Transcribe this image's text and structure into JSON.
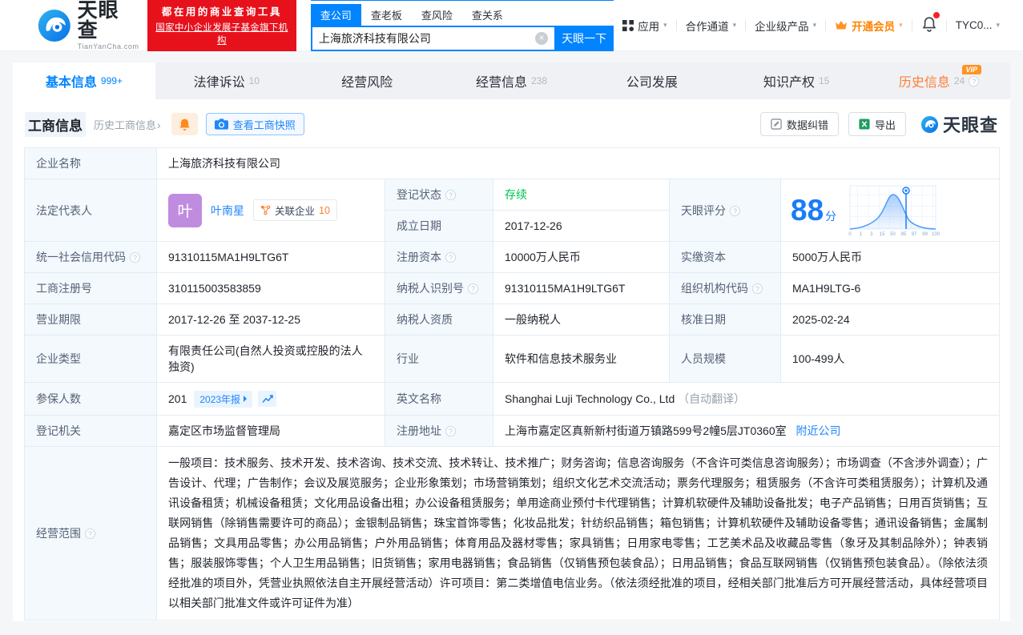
{
  "icons": {
    "caret_down": "▾",
    "clear": "×",
    "chevron_right": "›",
    "help": "?"
  },
  "colors": {
    "primary": "#0084ff",
    "link": "#2086fb",
    "orange": "#ff8200",
    "green": "#00c250",
    "red": "#e7111c",
    "score_blue": "#1a7cf8",
    "avatar_purple": "#c08ce0"
  },
  "header": {
    "logo": {
      "title": "天眼查",
      "subtitle": "TianYanCha.com"
    },
    "slogan_line1": "都在用的商业查询工具",
    "slogan_line2": "国家中小企业发展子基金旗下机构",
    "search_tabs": [
      {
        "label": "查公司"
      },
      {
        "label": "查老板"
      },
      {
        "label": "查风险"
      },
      {
        "label": "查关系"
      }
    ],
    "search_value": "上海旅济科技有限公司",
    "search_button": "天眼一下",
    "nav_app": "应用",
    "nav_partner": "合作通道",
    "nav_enterprise": "企业级产品",
    "nav_vip": "开通会员",
    "nav_user": "TYC0..."
  },
  "tabs": [
    {
      "label": "基本信息",
      "count": "999+"
    },
    {
      "label": "法律诉讼",
      "count": "10"
    },
    {
      "label": "经营风险",
      "count": ""
    },
    {
      "label": "经营信息",
      "count": "238"
    },
    {
      "label": "公司发展",
      "count": ""
    },
    {
      "label": "知识产权",
      "count": "15"
    },
    {
      "label": "历史信息",
      "count": "24",
      "vip": "VIP"
    }
  ],
  "section": {
    "title": "工商信息",
    "history_link": "历史工商信息",
    "snapshot_button": "查看工商快照",
    "correction_button": "数据纠错",
    "export_button": "导出",
    "watermark": "天眼查"
  },
  "company": {
    "name_label": "企业名称",
    "name": "上海旅济科技有限公司",
    "legal_label": "法定代表人",
    "legal_avatar": "叶",
    "legal_name": "叶南星",
    "related_label": "关联企业",
    "related_count": "10",
    "status_label": "登记状态",
    "status": "存续",
    "established_label": "成立日期",
    "established": "2017-12-26",
    "score_label": "天眼评分",
    "score": "88",
    "score_unit": "分",
    "score_ticks": [
      "0",
      "1",
      "3",
      "15",
      "50",
      "85",
      "97",
      "99",
      "100"
    ],
    "credit_code_label": "统一社会信用代码",
    "credit_code": "91310115MA1H9LTG6T",
    "reg_capital_label": "注册资本",
    "reg_capital": "10000万人民币",
    "paid_capital_label": "实缴资本",
    "paid_capital": "5000万人民币",
    "reg_no_label": "工商注册号",
    "reg_no": "310115003583859",
    "taxpayer_id_label": "纳税人识别号",
    "taxpayer_id": "91310115MA1H9LTG6T",
    "org_code_label": "组织机构代码",
    "org_code": "MA1H9LTG-6",
    "term_label": "营业期限",
    "term": "2017-12-26 至 2037-12-25",
    "taxpayer_quality_label": "纳税人资质",
    "taxpayer_quality": "一般纳税人",
    "approved_label": "核准日期",
    "approved": "2025-02-24",
    "type_label": "企业类型",
    "type": "有限责任公司(自然人投资或控股的法人独资)",
    "industry_label": "行业",
    "industry": "软件和信息技术服务业",
    "staff_label": "人员规模",
    "staff": "100-499人",
    "insured_label": "参保人数",
    "insured": "201",
    "insured_report": "2023年报",
    "en_name_label": "英文名称",
    "en_name": "Shanghai Luji Technology Co., Ltd",
    "en_name_note": "（自动翻译）",
    "authority_label": "登记机关",
    "authority": "嘉定区市场监督管理局",
    "address_label": "注册地址",
    "address": "上海市嘉定区真新新村街道万镇路599号2幢5层JT0360室",
    "address_link": "附近公司",
    "scope_label": "经营范围",
    "scope": "一般项目：技术服务、技术开发、技术咨询、技术交流、技术转让、技术推广；财务咨询；信息咨询服务（不含许可类信息咨询服务）；市场调查（不含涉外调查）；广告设计、代理；广告制作；会议及展览服务；企业形象策划；市场营销策划；组织文化艺术交流活动；票务代理服务；租赁服务（不含许可类租赁服务）；计算机及通讯设备租赁；机械设备租赁；文化用品设备出租；办公设备租赁服务；单用途商业预付卡代理销售；计算机软硬件及辅助设备批发；电子产品销售；日用百货销售；互联网销售（除销售需要许可的商品）；金银制品销售；珠宝首饰零售；化妆品批发；针纺织品销售；箱包销售；计算机软硬件及辅助设备零售；通讯设备销售；金属制品销售；文具用品零售；办公用品销售；户外用品销售；体育用品及器材零售；家具销售；日用家电零售；工艺美术品及收藏品零售（象牙及其制品除外）；钟表销售；服装服饰零售；个人卫生用品销售；旧货销售；家用电器销售；食品销售（仅销售预包装食品）；日用品销售；食品互联网销售（仅销售预包装食品）。（除依法须经批准的项目外，凭营业执照依法自主开展经营活动）许可项目：第二类增值电信业务。（依法须经批准的项目，经相关部门批准后方可开展经营活动，具体经营项目以相关部门批准文件或许可证件为准）"
  }
}
